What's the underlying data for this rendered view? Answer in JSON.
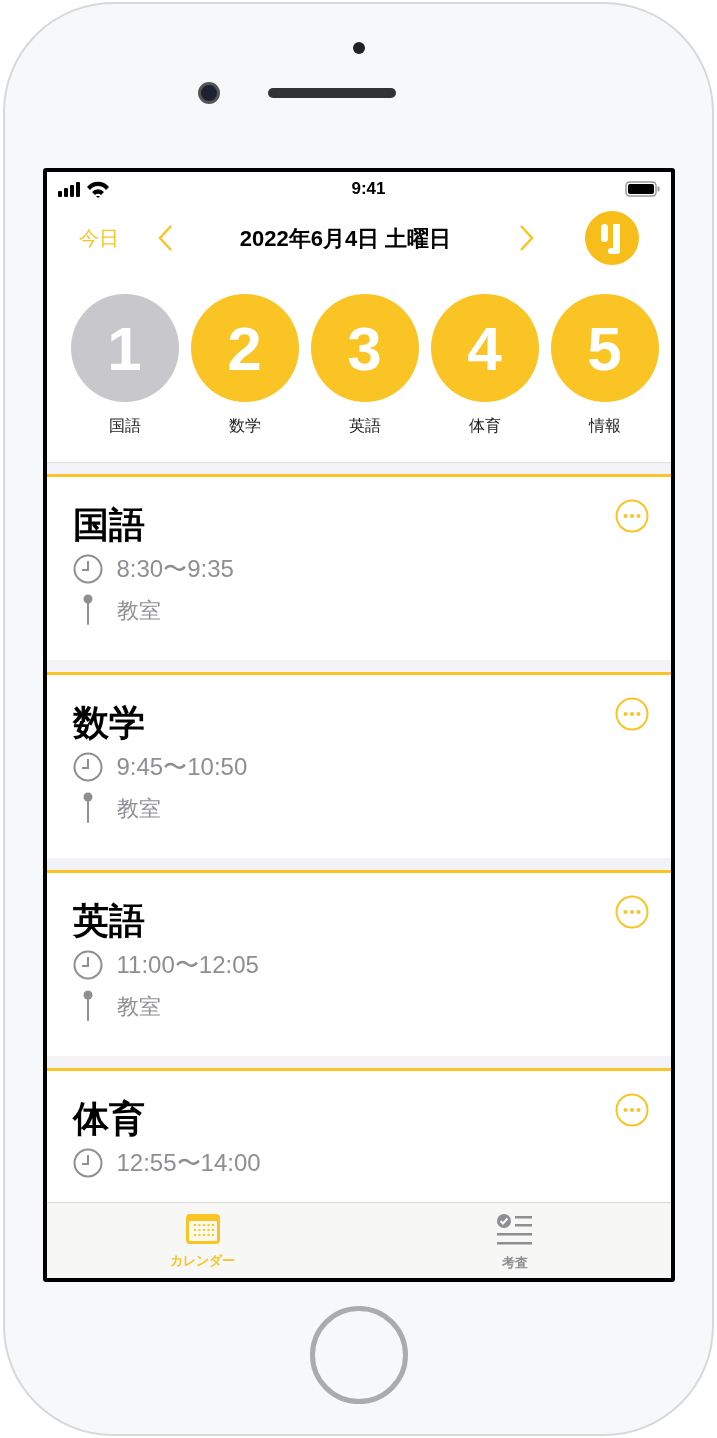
{
  "status_bar": {
    "time": "9:41"
  },
  "header": {
    "today": "今日",
    "date": "2022年6月4日 土曜日"
  },
  "periods": [
    {
      "number": "1",
      "subject": "国語",
      "completed": true
    },
    {
      "number": "2",
      "subject": "数学",
      "completed": false
    },
    {
      "number": "3",
      "subject": "英語",
      "completed": false
    },
    {
      "number": "4",
      "subject": "体育",
      "completed": false
    },
    {
      "number": "5",
      "subject": "情報",
      "completed": false
    }
  ],
  "classes": [
    {
      "subject": "国語",
      "time": "8:30〜9:35",
      "location": "教室"
    },
    {
      "subject": "数学",
      "time": "9:45〜10:50",
      "location": "教室"
    },
    {
      "subject": "英語",
      "time": "11:00〜12:05",
      "location": "教室"
    },
    {
      "subject": "体育",
      "time": "12:55〜14:00"
    }
  ],
  "tab_bar": [
    {
      "kind": "calendar",
      "label": "カレンダー",
      "selected": true
    },
    {
      "kind": "checklist",
      "label": "考査",
      "selected": false
    }
  ]
}
